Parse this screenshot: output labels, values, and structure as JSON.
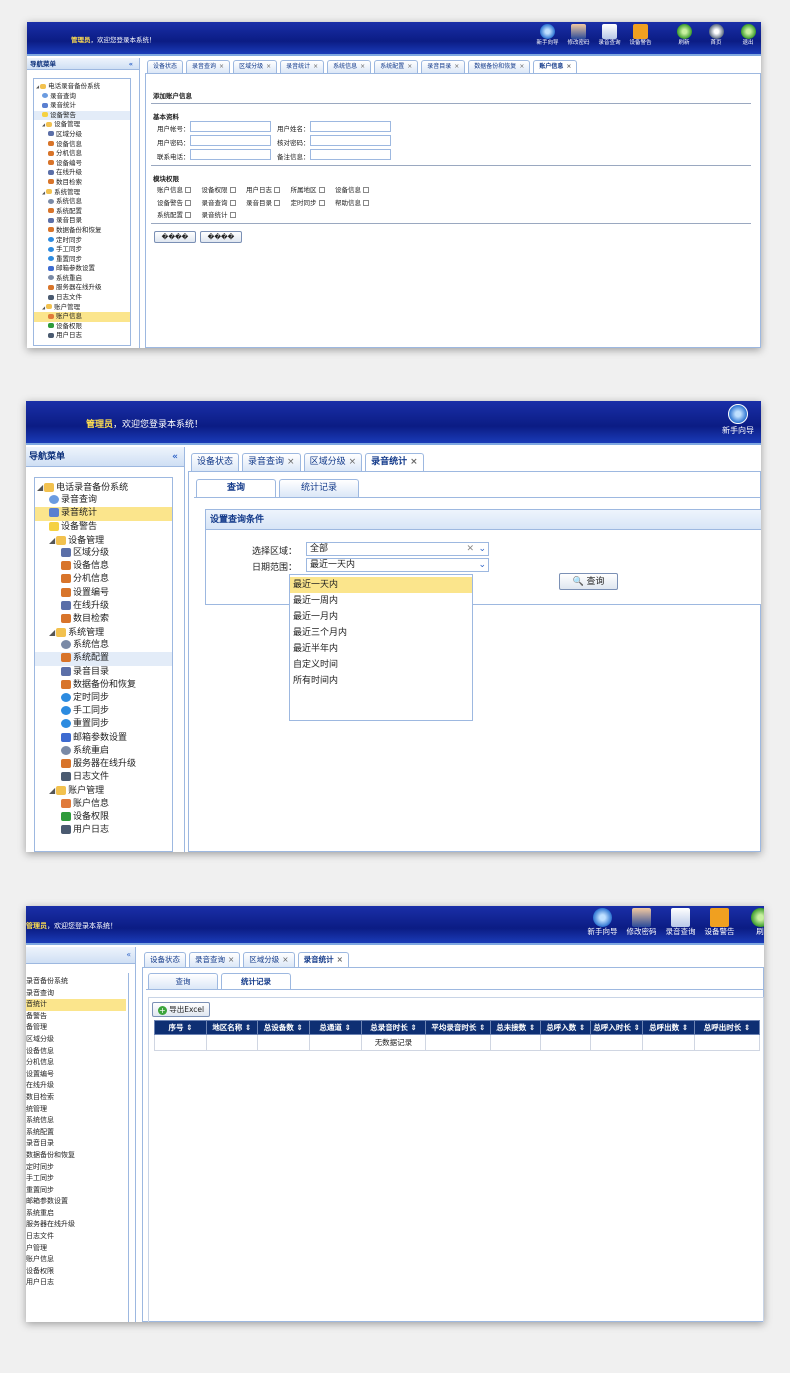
{
  "common": {
    "admin": "管理员",
    "welcome_suffix": "，欢迎您登录本系统！",
    "nav_title": "导航菜单",
    "collapse": "«",
    "tab_close": "×"
  },
  "s1": {
    "tools": [
      "新手向导",
      "修改密码",
      "录音查询",
      "设备警告"
    ],
    "tools_right": [
      "刷新",
      "首页",
      "退出"
    ],
    "tree": [
      {
        "label": "电话录音备份系统",
        "level": 0,
        "icon": "folder-icon"
      },
      {
        "label": "录音查询",
        "level": 1,
        "icon": "search-icon"
      },
      {
        "label": "录音统计",
        "level": 1,
        "icon": "chart-icon"
      },
      {
        "label": "设备警告",
        "level": 1,
        "icon": "bulb-icon",
        "state": "hover"
      },
      {
        "label": "设备管理",
        "level": 1,
        "icon": "folder-icon"
      },
      {
        "label": "区域分级",
        "level": 2,
        "icon": "edit-icon"
      },
      {
        "label": "设备信息",
        "level": 2,
        "icon": "tools-icon"
      },
      {
        "label": "分机信息",
        "level": 2,
        "icon": "tools-icon"
      },
      {
        "label": "设备编号",
        "level": 2,
        "icon": "tools-icon"
      },
      {
        "label": "在线升级",
        "level": 2,
        "icon": "edit-icon"
      },
      {
        "label": "数目检索",
        "level": 2,
        "icon": "tools-icon"
      },
      {
        "label": "系统管理",
        "level": 1,
        "icon": "folder-icon"
      },
      {
        "label": "系统信息",
        "level": 2,
        "icon": "gear-icon"
      },
      {
        "label": "系统配置",
        "level": 2,
        "icon": "tools-icon"
      },
      {
        "label": "录音目录",
        "level": 2,
        "icon": "edit-icon"
      },
      {
        "label": "数据备份和恢复",
        "level": 2,
        "icon": "tools-icon"
      },
      {
        "label": "定时同步",
        "level": 2,
        "icon": "clock-icon"
      },
      {
        "label": "手工同步",
        "level": 2,
        "icon": "clock-icon"
      },
      {
        "label": "重置同步",
        "level": 2,
        "icon": "clock-icon"
      },
      {
        "label": "邮箱参数设置",
        "level": 2,
        "icon": "mail-icon"
      },
      {
        "label": "系统重启",
        "level": 2,
        "icon": "gear-icon"
      },
      {
        "label": "服务器在线升级",
        "level": 2,
        "icon": "tools-icon"
      },
      {
        "label": "日志文件",
        "level": 2,
        "icon": "monitor-icon"
      },
      {
        "label": "账户管理",
        "level": 1,
        "icon": "folder-icon"
      },
      {
        "label": "账户信息",
        "level": 2,
        "icon": "user-icon",
        "state": "selected"
      },
      {
        "label": "设备权限",
        "level": 2,
        "icon": "shield-icon"
      },
      {
        "label": "用户日志",
        "level": 2,
        "icon": "monitor-icon"
      }
    ],
    "tabs": [
      "设备状态",
      "录音查询",
      "区域分级",
      "录音统计",
      "系统信息",
      "系统配置",
      "录音目录",
      "数据备份和恢复",
      "账户信息"
    ],
    "form_title": "添加账户信息",
    "basic_title": "基本资料",
    "fields": [
      "用户帐号：",
      "用户姓名：",
      "用户密码：",
      "核对密码：",
      "联系电话：",
      "备注信息："
    ],
    "perm_title": "模块权限",
    "perms": [
      "账户信息",
      "设备权限",
      "用户日志",
      "所属地区",
      "设备信息",
      "设备警告",
      "录音查询",
      "录音目录",
      "定时同步",
      "帮助信息",
      "系统配置",
      "录音统计"
    ],
    "buttons": [
      "����",
      "����"
    ]
  },
  "s2": {
    "tool": "新手向导",
    "tree": [
      {
        "label": "电话录音备份系统",
        "level": 0,
        "icon": "folder-icon"
      },
      {
        "label": "录音查询",
        "level": 1,
        "icon": "search-icon"
      },
      {
        "label": "录音统计",
        "level": 1,
        "icon": "chart-icon",
        "state": "selected"
      },
      {
        "label": "设备警告",
        "level": 1,
        "icon": "bulb-icon"
      },
      {
        "label": "设备管理",
        "level": 1,
        "icon": "folder-icon"
      },
      {
        "label": "区域分级",
        "level": 2,
        "icon": "edit-icon"
      },
      {
        "label": "设备信息",
        "level": 2,
        "icon": "tools-icon"
      },
      {
        "label": "分机信息",
        "level": 2,
        "icon": "tools-icon"
      },
      {
        "label": "设置编号",
        "level": 2,
        "icon": "tools-icon"
      },
      {
        "label": "在线升级",
        "level": 2,
        "icon": "edit-icon"
      },
      {
        "label": "数目检索",
        "level": 2,
        "icon": "tools-icon"
      },
      {
        "label": "系统管理",
        "level": 1,
        "icon": "folder-icon"
      },
      {
        "label": "系统信息",
        "level": 2,
        "icon": "gear-icon"
      },
      {
        "label": "系统配置",
        "level": 2,
        "icon": "tools-icon",
        "state": "hover"
      },
      {
        "label": "录音目录",
        "level": 2,
        "icon": "edit-icon"
      },
      {
        "label": "数据备份和恢复",
        "level": 2,
        "icon": "tools-icon"
      },
      {
        "label": "定时同步",
        "level": 2,
        "icon": "clock-icon"
      },
      {
        "label": "手工同步",
        "level": 2,
        "icon": "clock-icon"
      },
      {
        "label": "重置同步",
        "level": 2,
        "icon": "clock-icon"
      },
      {
        "label": "邮箱参数设置",
        "level": 2,
        "icon": "mail-icon"
      },
      {
        "label": "系统重启",
        "level": 2,
        "icon": "gear-icon"
      },
      {
        "label": "服务器在线升级",
        "level": 2,
        "icon": "tools-icon"
      },
      {
        "label": "日志文件",
        "level": 2,
        "icon": "monitor-icon"
      },
      {
        "label": "账户管理",
        "level": 1,
        "icon": "folder-icon"
      },
      {
        "label": "账户信息",
        "level": 2,
        "icon": "user-icon"
      },
      {
        "label": "设备权限",
        "level": 2,
        "icon": "shield-icon"
      },
      {
        "label": "用户日志",
        "level": 2,
        "icon": "monitor-icon"
      }
    ],
    "tabs": [
      "设备状态",
      "录音查询",
      "区域分级",
      "录音统计"
    ],
    "subtabs": [
      "查询",
      "统计记录"
    ],
    "panel_title": "设置查询条件",
    "region_label": "选择区域：",
    "region_value": "全部",
    "date_label": "日期范围：",
    "date_value": "最近一天内",
    "options": [
      "最近一天内",
      "最近一周内",
      "最近一月内",
      "最近三个月内",
      "最近半年内",
      "自定义时间",
      "所有时间内"
    ],
    "query_button": "查询"
  },
  "s3": {
    "tools": [
      "新手向导",
      "修改密码",
      "录音查询",
      "设备警告"
    ],
    "tool_cut": "刷",
    "tree": [
      "录音备份系统",
      "录音查询",
      "音统计",
      "备警告",
      "备管理",
      "区域分级",
      "设备信息",
      "分机信息",
      "设置编号",
      "在线升级",
      "数目检索",
      "统管理",
      "系统信息",
      "系统配置",
      "录音目录",
      "数据备份和恢复",
      "定时同步",
      "手工同步",
      "重置同步",
      "邮箱参数设置",
      "系统重启",
      "服务器在线升级",
      "日志文件",
      "户管理",
      "账户信息",
      "设备权限",
      "用户日志"
    ],
    "tabs": [
      "设备状态",
      "录音查询",
      "区域分级",
      "录音统计"
    ],
    "subtabs": [
      "查询",
      "统计记录"
    ],
    "export_button": "导出Excel",
    "columns": [
      "序号 ⇕",
      "地区名称 ⇕",
      "总设备数 ⇕",
      "总通道 ⇕",
      "总录音时长 ⇕",
      "平均录音时长 ⇕",
      "总未接数 ⇕",
      "总呼入数 ⇕",
      "总呼入时长 ⇕",
      "总呼出数 ⇕",
      "总呼出时长 ⇕"
    ],
    "empty_text": "无数据记录"
  }
}
